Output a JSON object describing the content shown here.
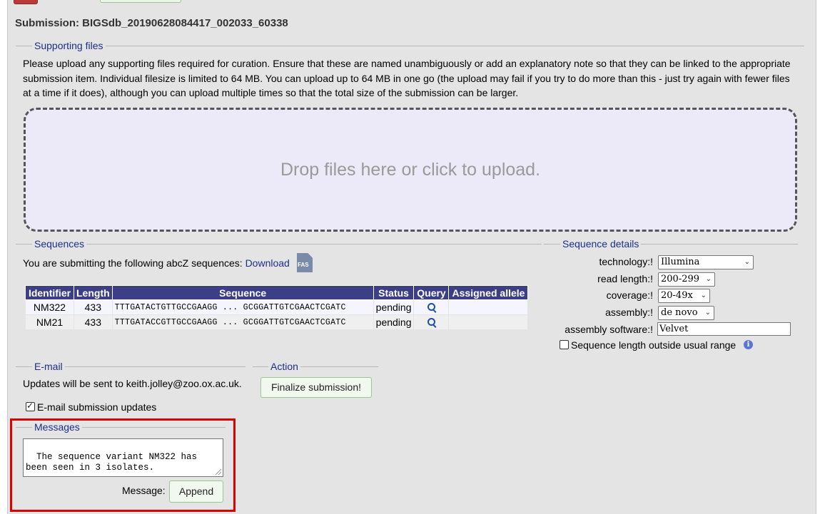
{
  "submission": {
    "title": "Submission: BIGSdb_20190628084417_002033_60338"
  },
  "supporting_files": {
    "legend": "Supporting files",
    "description": "Please upload any supporting files required for curation. Ensure that these are named unambiguously or add an explanatory note so that they can be linked to the appropriate submission item. Individual filesize is limited to 64 MB. You can upload up to 64 MB in one go (the upload may fail if you try to do more than this - just try again with fewer files at a time if it does), although you can upload multiple times so that the total size of the submission can be larger.",
    "dropzone_text": "Drop files here or click to upload."
  },
  "sequences": {
    "legend": "Sequences",
    "intro": "You are submitting the following abcZ sequences:",
    "download_label": "Download",
    "download_icon": "fas-file-icon",
    "download_icon_text": "FAS",
    "columns": [
      "Identifier",
      "Length",
      "Sequence",
      "Status",
      "Query",
      "Assigned allele"
    ],
    "rows": [
      {
        "identifier": "NM322",
        "length": "433",
        "sequence": "TTTGATACTGTTGCCGAAGG ... GCGGATTGTCGAACTCGATC",
        "status": "pending",
        "assigned": ""
      },
      {
        "identifier": "NM21",
        "length": "433",
        "sequence": "TTTGATACCGTTGCCGAAGG ... GCGGATTGTCGAACTCGATC",
        "status": "pending",
        "assigned": ""
      }
    ]
  },
  "sequence_details": {
    "legend": "Sequence details",
    "technology_label": "technology:!",
    "technology_value": "Illumina",
    "read_length_label": "read length:!",
    "read_length_value": "200-299",
    "coverage_label": "coverage:!",
    "coverage_value": "20-49x",
    "assembly_label": "assembly:!",
    "assembly_value": "de novo",
    "assembly_software_label": "assembly software:!",
    "assembly_software_value": "Velvet",
    "outside_range_label": "Sequence length outside usual range",
    "info_glyph": "i"
  },
  "email": {
    "legend": "E-mail",
    "text": "Updates will be sent to keith.jolley@zoo.ox.ac.uk.",
    "checkbox_label": "E-mail submission updates"
  },
  "action": {
    "legend": "Action",
    "finalize_label": "Finalize submission!"
  },
  "messages": {
    "legend": "Messages",
    "text": "The sequence variant NM322 has\nbeen seen in 3 isolates.",
    "message_label": "Message:",
    "append_label": "Append"
  }
}
